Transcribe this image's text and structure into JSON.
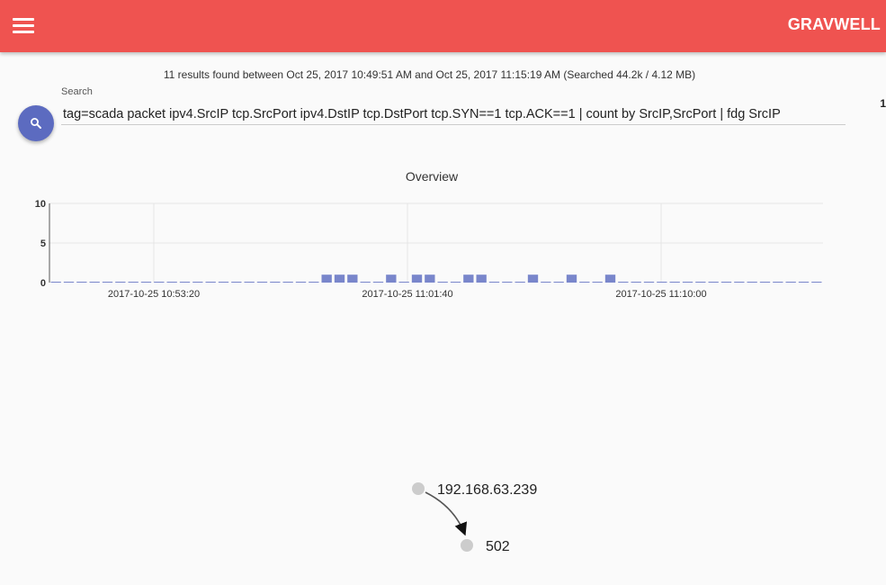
{
  "app": {
    "brand": "GRAVWELL"
  },
  "results": {
    "summary": "11 results found between Oct 25, 2017 10:49:51 AM and Oct 25, 2017 11:15:19 AM (Searched 44.2k / 4.12 MB)"
  },
  "search": {
    "label": "Search",
    "query": "tag=scada packet ipv4.SrcIP tcp.SrcPort ipv4.DstIP tcp.DstPort tcp.SYN==1 tcp.ACK==1 | count by SrcIP,SrcPort | fdg SrcIP",
    "edge_number": "1"
  },
  "icons": {
    "menu": "menu-icon",
    "search": "search-icon"
  },
  "colors": {
    "topbar": "#ef5350",
    "accent": "#5c6bc0",
    "bar": "#7986cb",
    "node": "#cccccc"
  },
  "chart_data": {
    "type": "bar",
    "title": "Overview",
    "ylim": [
      0,
      10
    ],
    "yticks": [
      "0",
      "5",
      "10"
    ],
    "xticks": [
      "2017-10-25 10:53:20",
      "2017-10-25 11:01:40",
      "2017-10-25 11:10:00"
    ],
    "grid": true,
    "bin_count": 60,
    "values": [
      0,
      0,
      0,
      0,
      0,
      0,
      0,
      0,
      0,
      0,
      0,
      0,
      0,
      0,
      0,
      0,
      0,
      0,
      0,
      0,
      0,
      1,
      1,
      1,
      0,
      0,
      1,
      0,
      1,
      1,
      0,
      0,
      1,
      1,
      0,
      0,
      0,
      1,
      0,
      0,
      1,
      0,
      0,
      1,
      0,
      0,
      0,
      0,
      0,
      0,
      0,
      0,
      0,
      0,
      0,
      0,
      0,
      0,
      0,
      0
    ]
  },
  "graph": {
    "nodes": [
      {
        "label": "192.168.63.239"
      },
      {
        "label": "502"
      }
    ],
    "edges": [
      {
        "from": 0,
        "to": 1
      }
    ]
  }
}
